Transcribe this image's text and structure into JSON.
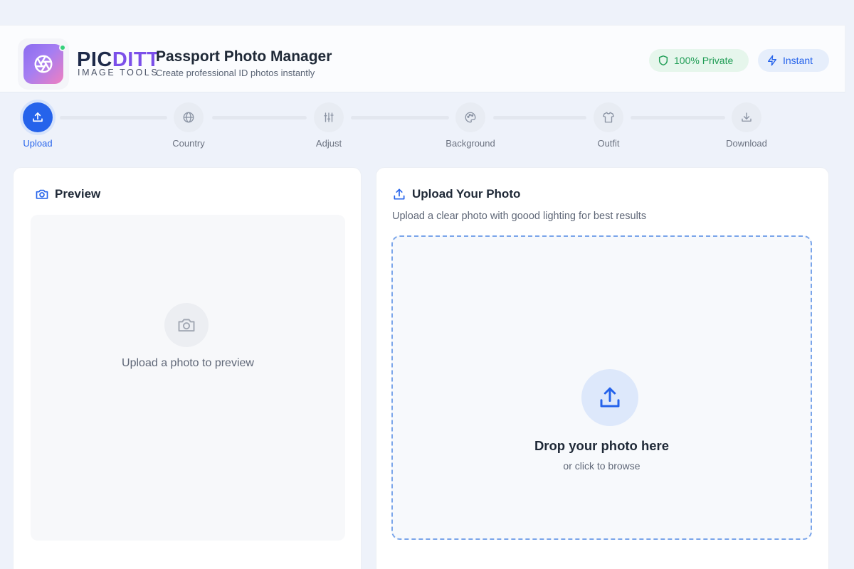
{
  "header": {
    "brand_part1": "PIC",
    "brand_part2": "DITT",
    "brand_sub": "IMAGE TOOLS",
    "title": "Passport Photo Manager",
    "subtitle": "Create professional ID photos instantly",
    "badges": [
      {
        "label": "100% Private",
        "icon": "shield-icon"
      },
      {
        "label": "Instant",
        "icon": "lightning-icon"
      }
    ]
  },
  "stepper": {
    "steps": [
      {
        "label": "Upload",
        "icon": "upload-icon",
        "active": true
      },
      {
        "label": "Country",
        "icon": "globe-icon",
        "active": false
      },
      {
        "label": "Adjust",
        "icon": "sliders-icon",
        "active": false
      },
      {
        "label": "Background",
        "icon": "palette-icon",
        "active": false
      },
      {
        "label": "Outfit",
        "icon": "shirt-icon",
        "active": false
      },
      {
        "label": "Download",
        "icon": "download-icon",
        "active": false
      }
    ]
  },
  "preview": {
    "title": "Preview",
    "placeholder": "Upload a photo to preview"
  },
  "upload": {
    "title": "Upload Your Photo",
    "description": "Upload a clear photo with goood lighting for best results",
    "drop_title": "Drop your photo here",
    "drop_sub": "or click to browse"
  },
  "colors": {
    "accent": "#2563eb",
    "brand_purple": "#7b4fe9",
    "success": "#1f9d55"
  }
}
